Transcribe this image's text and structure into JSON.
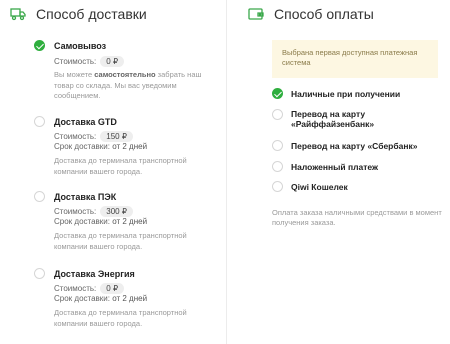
{
  "delivery": {
    "title": "Способ доставки",
    "icon": "truck-icon",
    "options": [
      {
        "name": "Самовывоз",
        "checked": true,
        "cost_label": "Стоимость:",
        "cost": "0 ₽",
        "desc_prefix": "Вы можете ",
        "desc_bold": "самостоятельно",
        "desc_suffix": " забрать наш товар со склада. Мы вас уведомим сообщением."
      },
      {
        "name": "Доставка GTD",
        "checked": false,
        "cost_label": "Стоимость:",
        "cost": "150 ₽",
        "term_label": "Срок доставки:",
        "term": "от 2 дней",
        "desc": "Доставка до терминала транспортной компании вашего города."
      },
      {
        "name": "Доставка ПЭК",
        "checked": false,
        "cost_label": "Стоимость:",
        "cost": "300 ₽",
        "term_label": "Срок доставки:",
        "term": "от 2 дней",
        "desc": "Доставка до терминала транспортной компании вашего города."
      },
      {
        "name": "Доставка Энергия",
        "checked": false,
        "cost_label": "Стоимость:",
        "cost": "0 ₽",
        "term_label": "Срок доставки:",
        "term": "от 2 дней",
        "desc": "Доставка до терминала транспортной компании вашего города."
      }
    ]
  },
  "payment": {
    "title": "Способ оплаты",
    "icon": "wallet-icon",
    "note": "Выбрана первая доступная платежная система",
    "options": [
      {
        "label": "Наличные при получении",
        "checked": true
      },
      {
        "label_line1": "Перевод на карту",
        "label_line2": "«Райффайзенбанк»",
        "checked": false
      },
      {
        "label": "Перевод на карту «Сбербанк»",
        "checked": false
      },
      {
        "label": "Наложенный платеж",
        "checked": false
      },
      {
        "label": "Qiwi Кошелек",
        "checked": false
      }
    ],
    "footer": "Оплата заказа наличными средствами в момент получения заказа."
  },
  "colors": {
    "accent": "#2eae3e",
    "note_bg": "#fdf7e2"
  }
}
